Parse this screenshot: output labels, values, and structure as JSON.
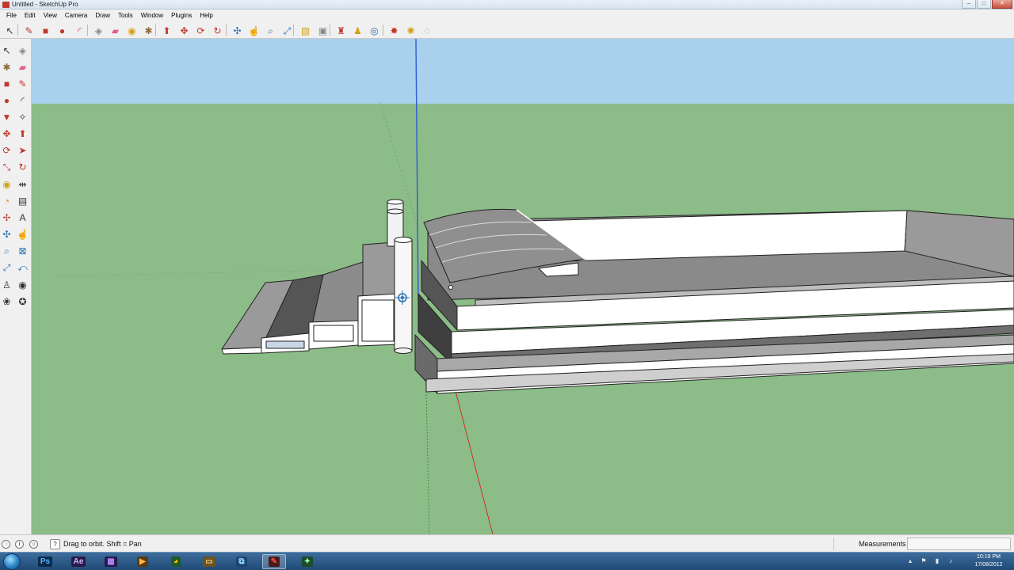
{
  "window": {
    "title": "Untitled - SketchUp Pro",
    "buttons": {
      "minimize": "–",
      "maximize": "□",
      "close": "✕"
    }
  },
  "menu": [
    "File",
    "Edit",
    "View",
    "Camera",
    "Draw",
    "Tools",
    "Window",
    "Plugins",
    "Help"
  ],
  "toolbar_top": [
    {
      "name": "select-icon",
      "glyph": "↖",
      "color": "#333333"
    },
    {
      "name": "pencil-icon",
      "glyph": "✎",
      "color": "#c0392b"
    },
    {
      "name": "rectangle-icon",
      "glyph": "■",
      "color": "#c0392b"
    },
    {
      "name": "circle-icon",
      "glyph": "●",
      "color": "#c0392b"
    },
    {
      "name": "arc-icon",
      "glyph": "◜",
      "color": "#c0392b"
    },
    {
      "name": "make-component-icon",
      "glyph": "◈",
      "color": "#7f8c8d"
    },
    {
      "name": "eraser-icon",
      "glyph": "▰",
      "color": "#e05d8c"
    },
    {
      "name": "tape-measure-icon",
      "glyph": "◉",
      "color": "#d4a017"
    },
    {
      "name": "paint-bucket-icon",
      "glyph": "✱",
      "color": "#8e6b3c"
    },
    {
      "name": "push-pull-icon",
      "glyph": "⬆",
      "color": "#c0392b"
    },
    {
      "name": "move-icon",
      "glyph": "✥",
      "color": "#c0392b"
    },
    {
      "name": "rotate-icon",
      "glyph": "⟳",
      "color": "#c0392b"
    },
    {
      "name": "offset-icon",
      "glyph": "↻",
      "color": "#c0392b"
    },
    {
      "name": "orbit-icon",
      "glyph": "✣",
      "color": "#2c6fb6"
    },
    {
      "name": "pan-icon",
      "glyph": "☝",
      "color": "#2c6fb6"
    },
    {
      "name": "zoom-icon",
      "glyph": "⌕",
      "color": "#2c6fb6"
    },
    {
      "name": "zoom-extents-icon",
      "glyph": "⤢",
      "color": "#2c6fb6"
    },
    {
      "name": "previous-view-icon",
      "glyph": "▧",
      "color": "#d4a017"
    },
    {
      "name": "position-camera-icon",
      "glyph": "▣",
      "color": "#888888"
    },
    {
      "name": "get-models-icon",
      "glyph": "♜",
      "color": "#c0392b"
    },
    {
      "name": "share-model-icon",
      "glyph": "♟",
      "color": "#d4a017"
    },
    {
      "name": "components-icon",
      "glyph": "◎",
      "color": "#2c6fb6"
    },
    {
      "name": "extension-warehouse-icon",
      "glyph": "✸",
      "color": "#c0392b"
    },
    {
      "name": "ruby-icon",
      "glyph": "✺",
      "color": "#d4a017"
    },
    {
      "name": "layout-icon",
      "glyph": "◌",
      "color": "#999999"
    }
  ],
  "toolbar_left": [
    {
      "name": "select-icon",
      "glyph": "↖",
      "color": "#333333"
    },
    {
      "name": "make-component-icon",
      "glyph": "◈",
      "color": "#888888"
    },
    {
      "name": "paint-bucket-icon",
      "glyph": "✱",
      "color": "#8e6b3c"
    },
    {
      "name": "eraser-icon",
      "glyph": "▰",
      "color": "#e05d8c"
    },
    {
      "name": "rectangle-icon",
      "glyph": "■",
      "color": "#c0392b"
    },
    {
      "name": "line-icon",
      "glyph": "✎",
      "color": "#c0392b"
    },
    {
      "name": "circle-icon",
      "glyph": "●",
      "color": "#c0392b"
    },
    {
      "name": "arc-icon",
      "glyph": "◜",
      "color": "#333333"
    },
    {
      "name": "polygon-icon",
      "glyph": "▼",
      "color": "#c0392b"
    },
    {
      "name": "freehand-icon",
      "glyph": "✧",
      "color": "#333333"
    },
    {
      "name": "move-icon",
      "glyph": "✥",
      "color": "#c0392b"
    },
    {
      "name": "push-pull-icon",
      "glyph": "⬆",
      "color": "#c0392b"
    },
    {
      "name": "rotate-icon",
      "glyph": "⟳",
      "color": "#c0392b"
    },
    {
      "name": "follow-me-icon",
      "glyph": "➤",
      "color": "#c0392b"
    },
    {
      "name": "scale-icon",
      "glyph": "⤡",
      "color": "#c0392b"
    },
    {
      "name": "offset-icon",
      "glyph": "↻",
      "color": "#c0392b"
    },
    {
      "name": "tape-measure-icon",
      "glyph": "◉",
      "color": "#d4a017"
    },
    {
      "name": "dimension-icon",
      "glyph": "⇹",
      "color": "#333333"
    },
    {
      "name": "protractor-icon",
      "glyph": "◔",
      "color": "#d4a017"
    },
    {
      "name": "text-icon",
      "glyph": "▤",
      "color": "#333333"
    },
    {
      "name": "axes-icon",
      "glyph": "✢",
      "color": "#c0392b"
    },
    {
      "name": "3d-text-icon",
      "glyph": "A",
      "color": "#333333"
    },
    {
      "name": "orbit-icon",
      "glyph": "✣",
      "color": "#2c6fb6"
    },
    {
      "name": "pan-icon",
      "glyph": "☝",
      "color": "#2c6fb6"
    },
    {
      "name": "zoom-icon",
      "glyph": "⌕",
      "color": "#2c6fb6"
    },
    {
      "name": "zoom-window-icon",
      "glyph": "⊠",
      "color": "#2c6fb6"
    },
    {
      "name": "zoom-extents-icon",
      "glyph": "⤢",
      "color": "#2c6fb6"
    },
    {
      "name": "previous-icon",
      "glyph": "⤺",
      "color": "#2c6fb6"
    },
    {
      "name": "position-camera-icon",
      "glyph": "♙",
      "color": "#333333"
    },
    {
      "name": "look-around-icon",
      "glyph": "◉",
      "color": "#333333"
    },
    {
      "name": "walk-icon",
      "glyph": "❀",
      "color": "#333333"
    },
    {
      "name": "section-plane-icon",
      "glyph": "✪",
      "color": "#333333"
    }
  ],
  "viewport": {
    "sky_color": "#a9d0ec",
    "ground_color": "#8cbc88",
    "axis_colors": {
      "blue": "#2d59d6",
      "red": "#cc3322",
      "green": "#2e8b2e"
    }
  },
  "statusbar": {
    "hint": "Drag to orbit.  Shift = Pan",
    "measurements_label": "Measurements",
    "measurements_value": ""
  },
  "taskbar": {
    "apps": [
      {
        "name": "photoshop-icon",
        "glyph": "Ps",
        "color": "#4fb4ff",
        "bg": "#0b2a4a"
      },
      {
        "name": "after-effects-icon",
        "glyph": "Ae",
        "color": "#c8b6ff",
        "bg": "#2a1a4a"
      },
      {
        "name": "media-encoder-icon",
        "glyph": "▦",
        "color": "#b08cff",
        "bg": "#26184a"
      },
      {
        "name": "media-player-icon",
        "glyph": "▶",
        "color": "#ffb347",
        "bg": "#5a3a10"
      },
      {
        "name": "chrome-icon",
        "glyph": "◕",
        "color": "#f1c40f",
        "bg": "#1f5a2a"
      },
      {
        "name": "explorer-icon",
        "glyph": "▭",
        "color": "#f4d27a",
        "bg": "#6b5220"
      },
      {
        "name": "network-icon",
        "glyph": "⧉",
        "color": "#9ee0ff",
        "bg": "#1c4670"
      },
      {
        "name": "sketchup-icon",
        "glyph": "✎",
        "color": "#e74c3c",
        "bg": "#4a1a1a"
      },
      {
        "name": "app-icon",
        "glyph": "✦",
        "color": "#a0ffb0",
        "bg": "#1d4a2a"
      }
    ],
    "tray": [
      "▴",
      "⚑",
      "▮",
      "♪"
    ],
    "time": "10:19 PM",
    "date": "17/08/2012"
  }
}
